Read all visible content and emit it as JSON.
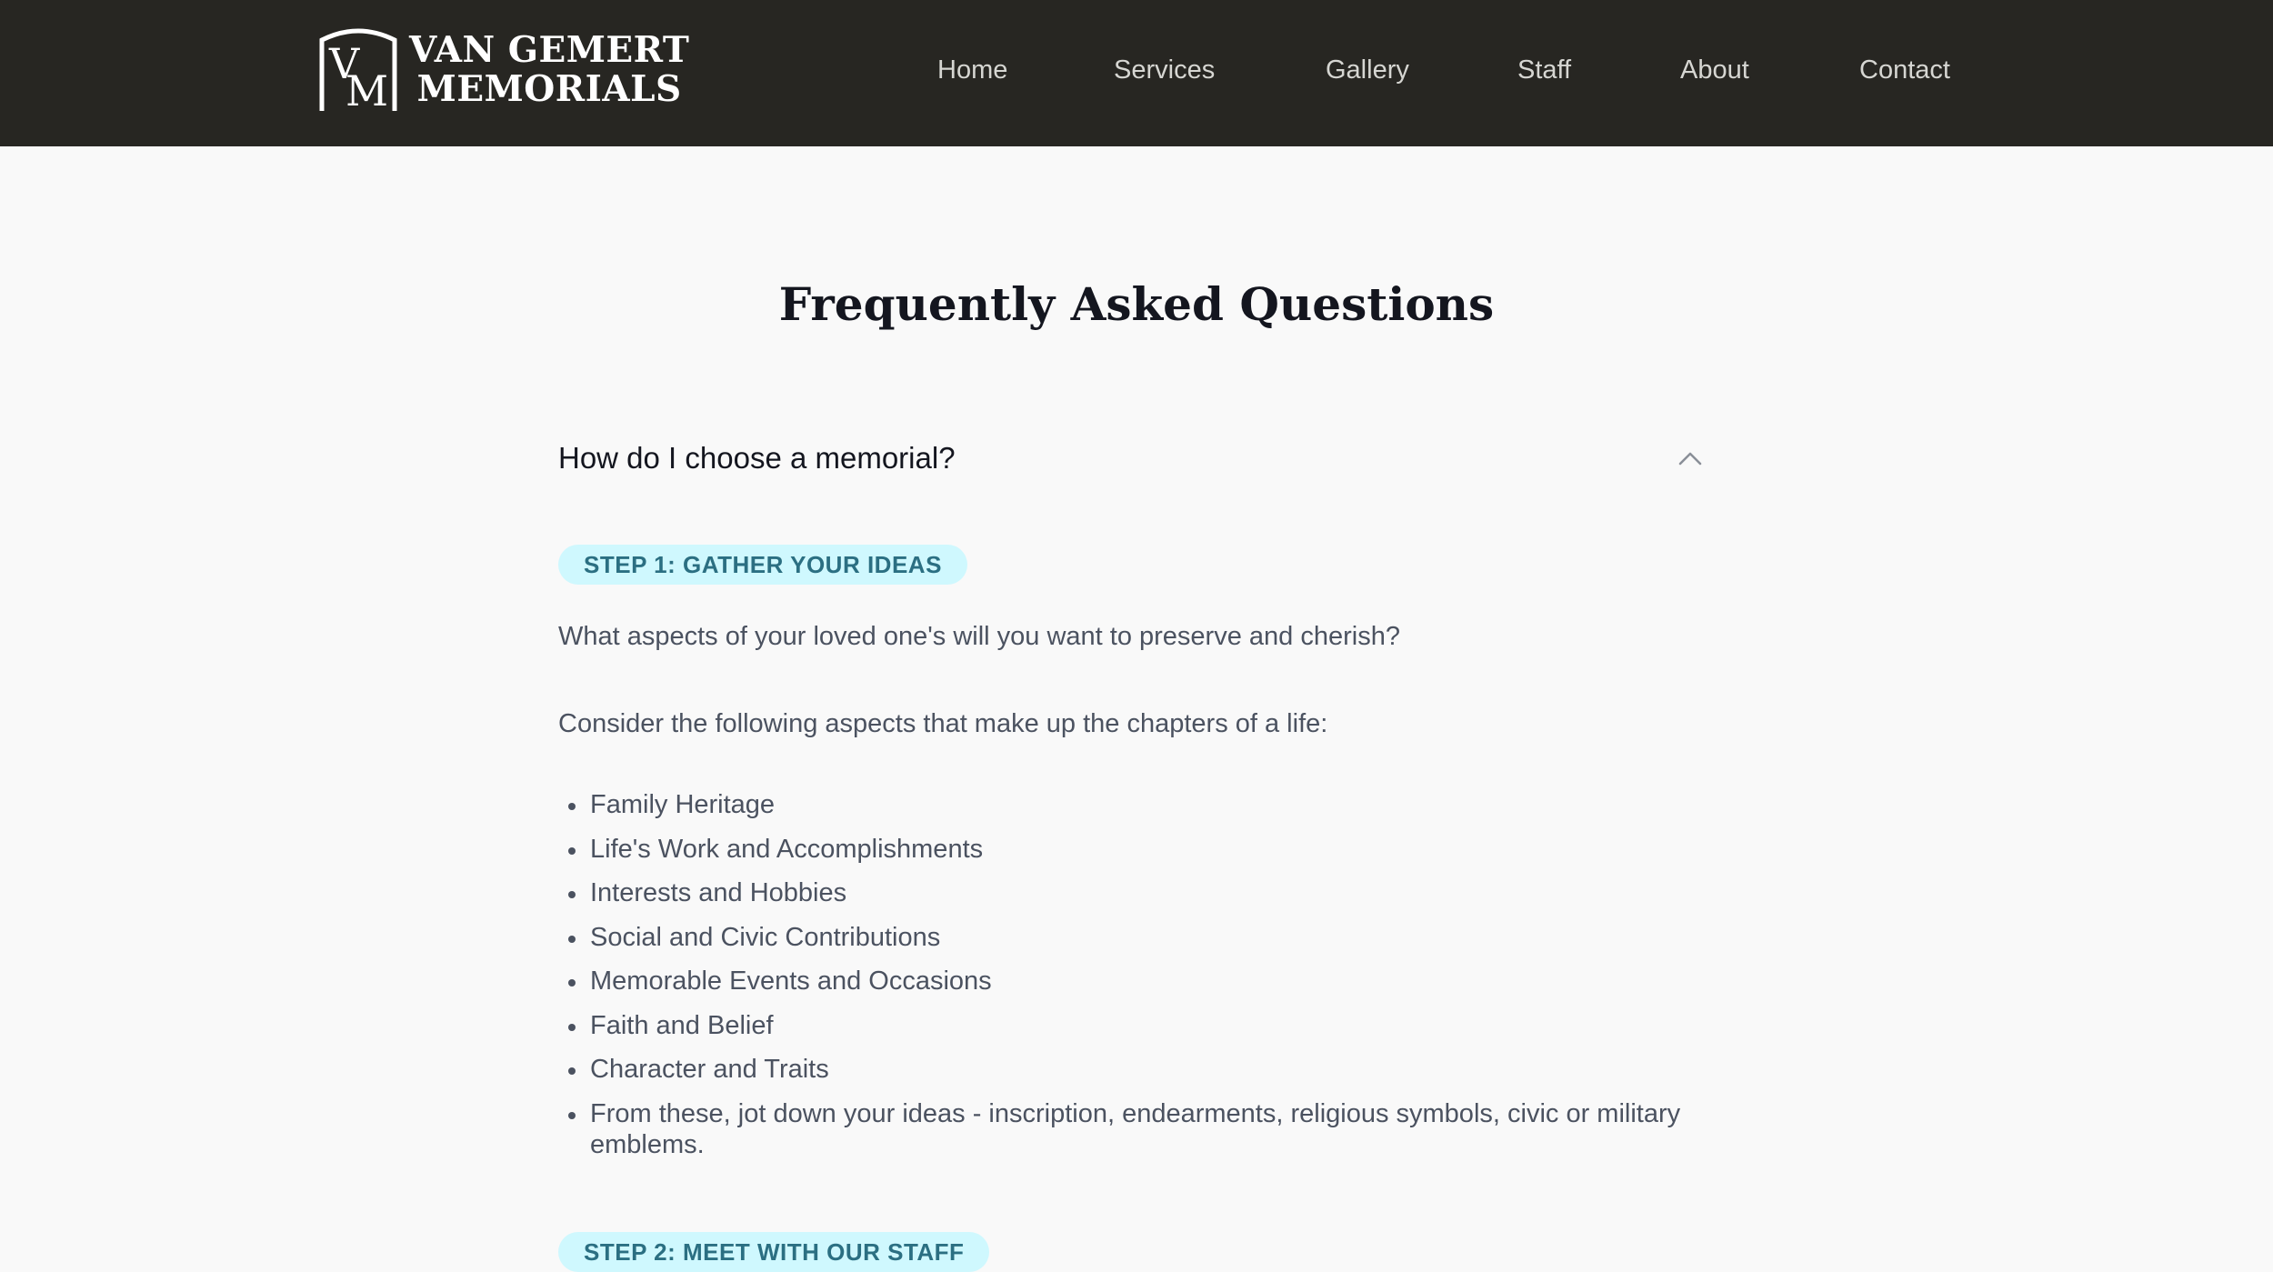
{
  "header": {
    "logo": {
      "monogram": "VM",
      "line1": "VAN GEMERT",
      "line2": "MEMORIALS"
    },
    "nav": [
      {
        "label": "Home"
      },
      {
        "label": "Services"
      },
      {
        "label": "Gallery"
      },
      {
        "label": "Staff"
      },
      {
        "label": "About"
      },
      {
        "label": "Contact"
      }
    ]
  },
  "main": {
    "title": "Frequently Asked Questions",
    "faq": {
      "question": "How do I choose a memorial?",
      "expanded": true,
      "toggle_icon": "chevron-up-icon",
      "step1": {
        "badge": "STEP 1: GATHER YOUR IDEAS",
        "intro": "What aspects of your loved one's will you want to preserve and cherish?",
        "lead": "Consider the following aspects that make up the chapters of a life:",
        "items": [
          "Family Heritage",
          "Life's Work and Accomplishments",
          "Interests and Hobbies",
          "Social and Civic Contributions",
          "Memorable Events and Occasions",
          "Faith and Belief",
          "Character and Traits",
          "From these, jot down your ideas - inscription, endearments, religious symbols, civic or military emblems."
        ]
      },
      "step2": {
        "badge": "STEP 2: MEET WITH OUR STAFF"
      }
    }
  },
  "colors": {
    "header_bg": "#272622",
    "page_bg": "#f9f9f9",
    "badge_bg": "#cff8fe",
    "badge_text": "#2b6f82",
    "body_text": "#4b5260",
    "heading_text": "#14161f"
  }
}
